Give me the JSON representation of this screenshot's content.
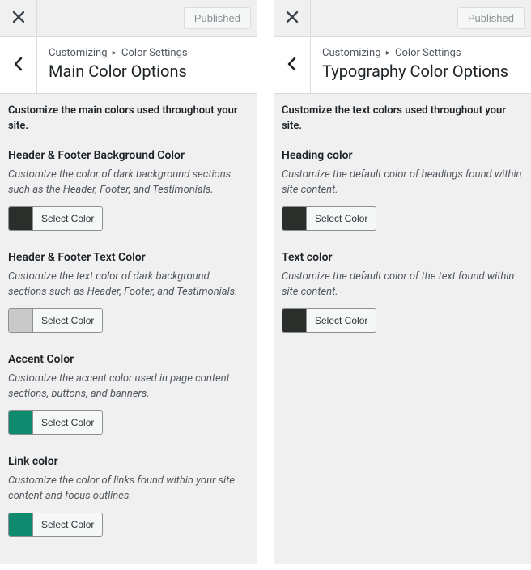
{
  "panels": [
    {
      "published_label": "Published",
      "breadcrumb_prefix": "Customizing",
      "breadcrumb_section": "Color Settings",
      "title": "Main Color Options",
      "intro": "Customize the main colors used throughout your site.",
      "controls": [
        {
          "label": "Header & Footer Background Color",
          "desc": "Customize the color of dark background sections such as the Header, Footer, and Testimonials.",
          "color": "#2a2f2c",
          "button": "Select Color"
        },
        {
          "label": "Header & Footer Text Color",
          "desc": "Customize the text color of dark background sections such as Header, Footer, and Testimonials.",
          "color": "#c9c9c9",
          "button": "Select Color"
        },
        {
          "label": "Accent Color",
          "desc": "Customize the accent color used in page content sections, buttons, and banners.",
          "color": "#0f8a6e",
          "button": "Select Color"
        },
        {
          "label": "Link color",
          "desc": "Customize the color of links found within your site content and focus outlines.",
          "color": "#0f8a6e",
          "button": "Select Color"
        }
      ]
    },
    {
      "published_label": "Published",
      "breadcrumb_prefix": "Customizing",
      "breadcrumb_section": "Color Settings",
      "title": "Typography Color Options",
      "intro": "Customize the text colors used throughout your site.",
      "controls": [
        {
          "label": "Heading color",
          "desc": "Customize the default color of headings found within site content.",
          "color": "#2a2f2c",
          "button": "Select Color"
        },
        {
          "label": "Text color",
          "desc": "Customize the default color of the text found within site content.",
          "color": "#2a2f2c",
          "button": "Select Color"
        }
      ]
    }
  ]
}
